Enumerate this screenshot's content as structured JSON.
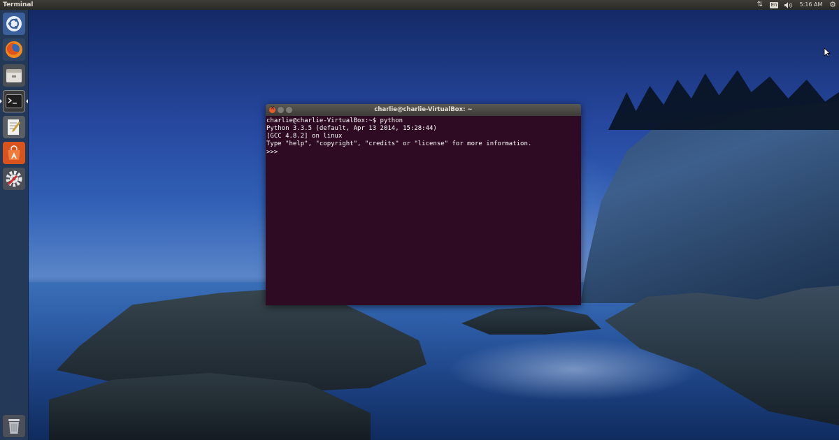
{
  "top_panel": {
    "active_app": "Terminal",
    "keyboard_layout": "En",
    "clock": "5:16 AM"
  },
  "launcher": {
    "items": [
      {
        "name": "dash",
        "icon": "ubuntu-logo-icon"
      },
      {
        "name": "firefox",
        "icon": "firefox-icon"
      },
      {
        "name": "files",
        "icon": "files-icon"
      },
      {
        "name": "terminal",
        "icon": "terminal-icon",
        "active": true
      },
      {
        "name": "text-editor",
        "icon": "text-editor-icon"
      },
      {
        "name": "software-center",
        "icon": "software-center-icon"
      },
      {
        "name": "system-settings",
        "icon": "settings-icon"
      }
    ],
    "trash": {
      "icon": "trash-icon"
    }
  },
  "terminal": {
    "title": "charlie@charlie-VirtualBox: ~",
    "lines": [
      "charlie@charlie-VirtualBox:~$ python",
      "Python 3.3.5 (default, Apr 13 2014, 15:28:44)",
      "[GCC 4.8.2] on linux",
      "Type \"help\", \"copyright\", \"credits\" or \"license\" for more information.",
      ">>>"
    ]
  },
  "colors": {
    "panel": "#2b2a26",
    "launcher": "#243858",
    "terminal_background": "#2f0a23",
    "close_button": "#e35c2e"
  }
}
